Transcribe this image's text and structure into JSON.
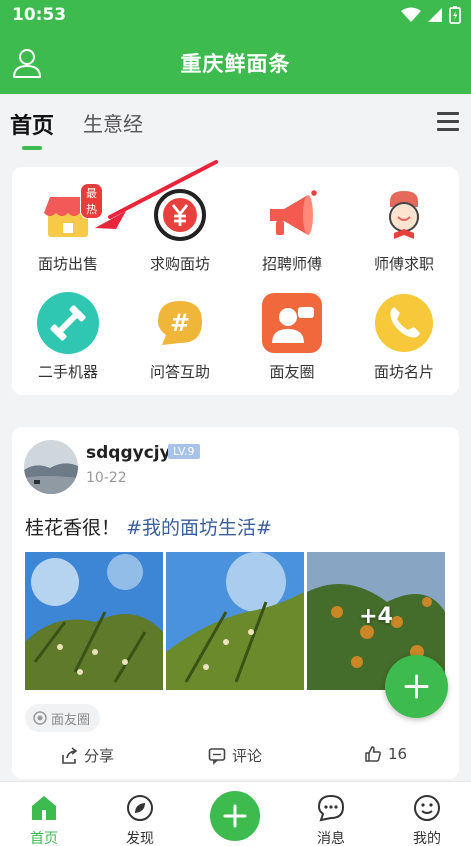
{
  "status_bar": {
    "time": "10:53"
  },
  "app_bar": {
    "title": "重庆鲜面条"
  },
  "tabs": [
    {
      "label": "首页",
      "active": true
    },
    {
      "label": "生意经",
      "active": false
    }
  ],
  "grid": {
    "hot_badge": "最热",
    "items": [
      {
        "label": "面坊出售",
        "icon": "shop-icon"
      },
      {
        "label": "求购面坊",
        "icon": "yuan-coin-icon"
      },
      {
        "label": "招聘师傅",
        "icon": "megaphone-icon"
      },
      {
        "label": "师傅求职",
        "icon": "chef-icon"
      },
      {
        "label": "二手机器",
        "icon": "dumbbell-icon"
      },
      {
        "label": "问答互助",
        "icon": "hash-bubble-icon"
      },
      {
        "label": "面友圈",
        "icon": "friends-icon"
      },
      {
        "label": "面坊名片",
        "icon": "phone-icon"
      }
    ]
  },
  "post": {
    "username": "sdqgycjy",
    "level": "LV.9",
    "date": "10-22",
    "text": "桂花香很！",
    "tag": "#我的面坊生活#",
    "more_count": "+4",
    "circle": "面友圈",
    "share_label": "分享",
    "comment_label": "评论",
    "like_count": "16"
  },
  "bottom_nav": [
    {
      "label": "首页",
      "active": true
    },
    {
      "label": "发现",
      "active": false
    },
    {
      "label": "消息",
      "active": false
    },
    {
      "label": "我的",
      "active": false
    }
  ],
  "colors": {
    "brand": "#3dbb4f",
    "tag": "#3b5f9c",
    "hot": "#e83b3b"
  }
}
